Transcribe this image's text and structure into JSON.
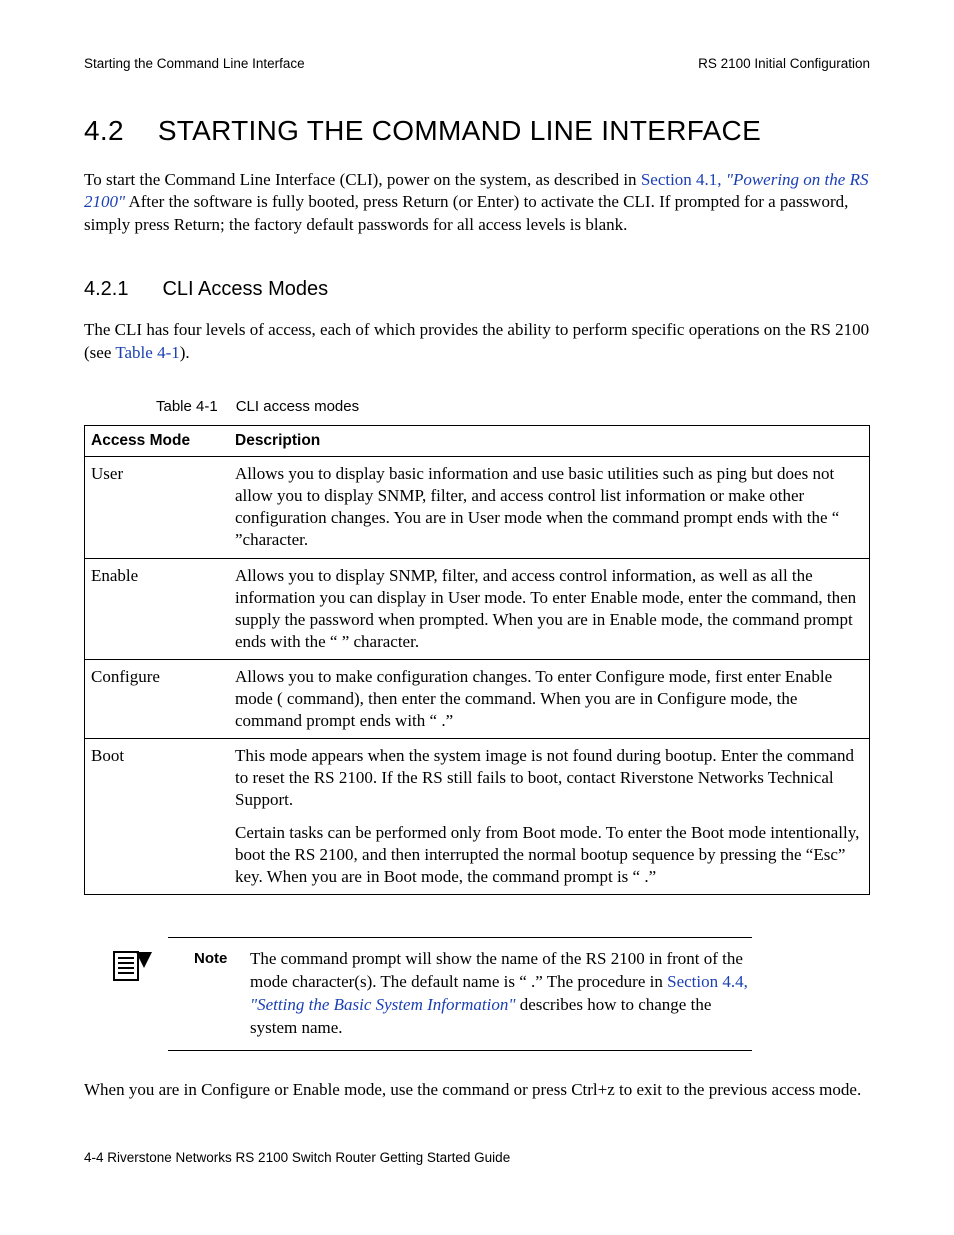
{
  "header": {
    "left": "Starting the Command Line Interface",
    "right": "RS 2100 Initial Configuration"
  },
  "title": {
    "num": "4.2",
    "text": "STARTING THE COMMAND LINE INTERFACE"
  },
  "intro": {
    "pre": "To start the Command Line Interface (CLI), power on the system, as described in ",
    "link1a": "Section 4.1, ",
    "link1b": "\"Powering on the RS 2100\"",
    "post": " After the software is fully booted, press Return (or Enter) to activate the CLI. If prompted for a password, simply press Return; the factory default passwords for all access levels is blank."
  },
  "sub": {
    "num": "4.2.1",
    "text": "CLI Access Modes"
  },
  "subpara": {
    "pre": "The CLI has four levels of access, each of which provides the ability to perform specific operations on the RS 2100 (see ",
    "link": "Table 4-1",
    "post": ")."
  },
  "table": {
    "caption_num": "Table 4-1",
    "caption_text": "CLI access modes",
    "h1": "Access Mode",
    "h2": "Description",
    "rows": {
      "user": {
        "mode": "User",
        "desc": "Allows you to display basic information and use basic utilities such as ping but does not allow you to display SNMP, filter, and access control list information or make other configuration changes. You are in User mode when the command prompt ends with the “   ”character."
      },
      "enable": {
        "mode": "Enable",
        "desc": "Allows you to display SNMP, filter, and access control information, as well as all the information you can display in User mode. To enter Enable mode, enter the               command, then supply the password when prompted. When you are in Enable mode, the command prompt ends with the “   ” character."
      },
      "configure": {
        "mode": "Configure",
        "desc": "Allows you to make configuration changes. To enter Configure mode, first enter Enable mode (              command), then enter the                       command. When you are in Configure mode, the command prompt ends with “              .”"
      },
      "boot": {
        "mode": "Boot",
        "desc1": "This mode appears when the system image is not found during bootup. Enter the command to reset the RS 2100. If the RS still fails to boot, contact Riverstone Networks Technical Support.",
        "desc2": "Certain tasks can be performed only from Boot mode. To enter the Boot mode intentionally, boot the RS 2100, and then interrupted the normal bootup sequence by pressing the “Esc” key. When you are in Boot mode, the command prompt is “                .”"
      }
    }
  },
  "note": {
    "label": "Note",
    "pre": "The command prompt will show the name of the RS 2100 in front of the mode character(s). The default name is “    .” The procedure in ",
    "link_a": "Section 4.4, ",
    "link_b": "\"Setting the Basic System Information\"",
    "post": " describes how to change the system name."
  },
  "tail": "When you are in Configure or Enable mode, use the          command or press Ctrl+z to exit to the previous access mode.",
  "footer": "4-4   Riverstone Networks RS 2100 Switch Router Getting Started Guide"
}
